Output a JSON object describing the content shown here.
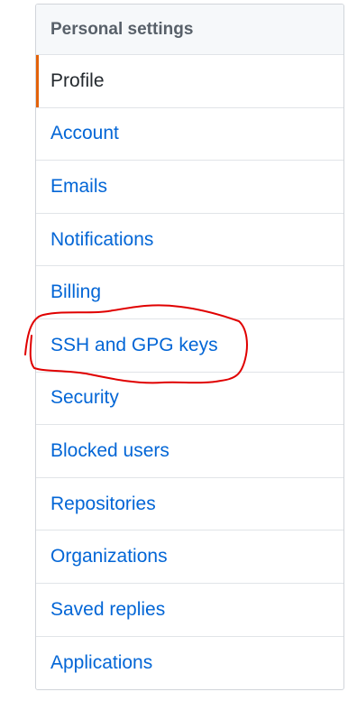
{
  "menu": {
    "heading": "Personal settings",
    "items": [
      {
        "label": "Profile",
        "selected": true
      },
      {
        "label": "Account"
      },
      {
        "label": "Emails"
      },
      {
        "label": "Notifications"
      },
      {
        "label": "Billing"
      },
      {
        "label": "SSH and GPG keys"
      },
      {
        "label": "Security"
      },
      {
        "label": "Blocked users"
      },
      {
        "label": "Repositories"
      },
      {
        "label": "Organizations"
      },
      {
        "label": "Saved replies"
      },
      {
        "label": "Applications"
      }
    ]
  },
  "colors": {
    "link": "#0366d6",
    "selected_text": "#24292e",
    "selected_accent": "#e36209",
    "heading_bg": "#f6f8fa",
    "annotation": "#e00000"
  }
}
